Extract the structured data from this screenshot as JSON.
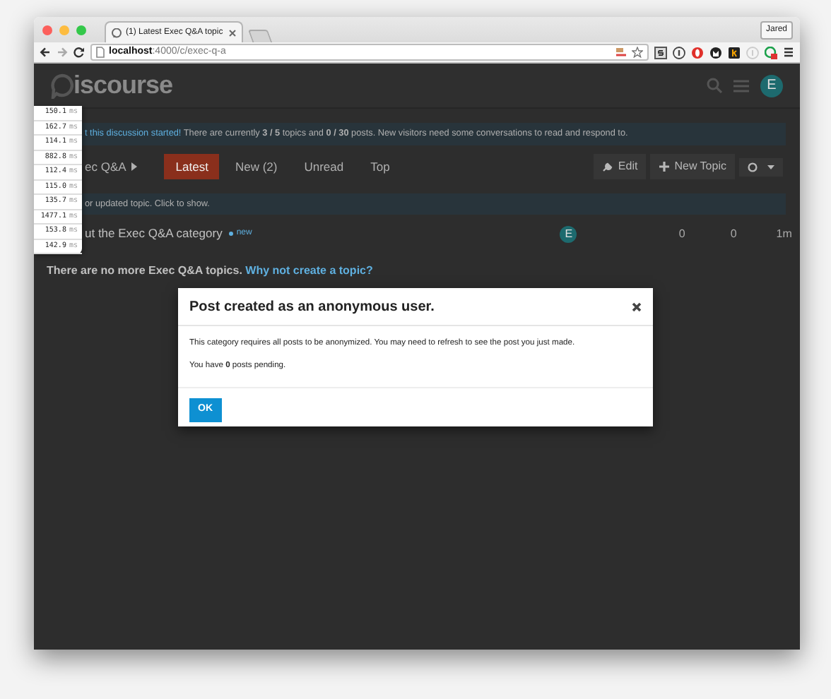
{
  "browser": {
    "tabs": [
      {
        "title": "(1) Latest Exec Q&A topic",
        "selected": true
      }
    ],
    "profile": "Jared",
    "url": "**localhost**:4000/c/exec-q-a"
  },
  "site": {
    "logo": "iscourse",
    "avatar": "E"
  },
  "banner": {
    "link": "t this discussion started!",
    "text": "There are currently **3 / 5** topics and **0 / 30** posts. New visitors need some conversations to read and respond to."
  },
  "nav": {
    "category": "ec Q&A",
    "tabs": [
      {
        "label": "Latest",
        "selected": true
      },
      {
        "label": "New (2)",
        "selected": false
      },
      {
        "label": "Unread",
        "selected": false
      },
      {
        "label": "Top",
        "selected": false
      }
    ],
    "actions": [
      "Edit",
      "New Topic"
    ]
  },
  "alert": "or updated topic. Click to show.",
  "topics": [
    {
      "title": "ut the Exec Q&A category",
      "badge": "new",
      "avatar": "E",
      "replies": "0",
      "views": "0",
      "activity": "1m"
    }
  ],
  "footer": {
    "text": "There are no more Exec Q&A topics.",
    "link": "Why not create a topic?"
  },
  "timings": [
    {
      "value": "150.1",
      "unit": "ms"
    },
    {
      "value": "162.7",
      "unit": "ms"
    },
    {
      "value": "114.1",
      "unit": "ms"
    },
    {
      "value": "882.8",
      "unit": "ms"
    },
    {
      "value": "112.4",
      "unit": "ms"
    },
    {
      "value": "115.0",
      "unit": "ms"
    },
    {
      "value": "135.7",
      "unit": "ms"
    },
    {
      "value": "1477.1",
      "unit": "ms"
    },
    {
      "value": "153.8",
      "unit": "ms"
    },
    {
      "value": "142.9",
      "unit": "ms"
    }
  ],
  "modal": {
    "title": "Post created as an anonymous user.",
    "paragraphs": [
      "This category requires all posts to be anonymized. You may need to refresh to see the post you just made.",
      "You have **0** posts pending."
    ],
    "button": "OK"
  }
}
